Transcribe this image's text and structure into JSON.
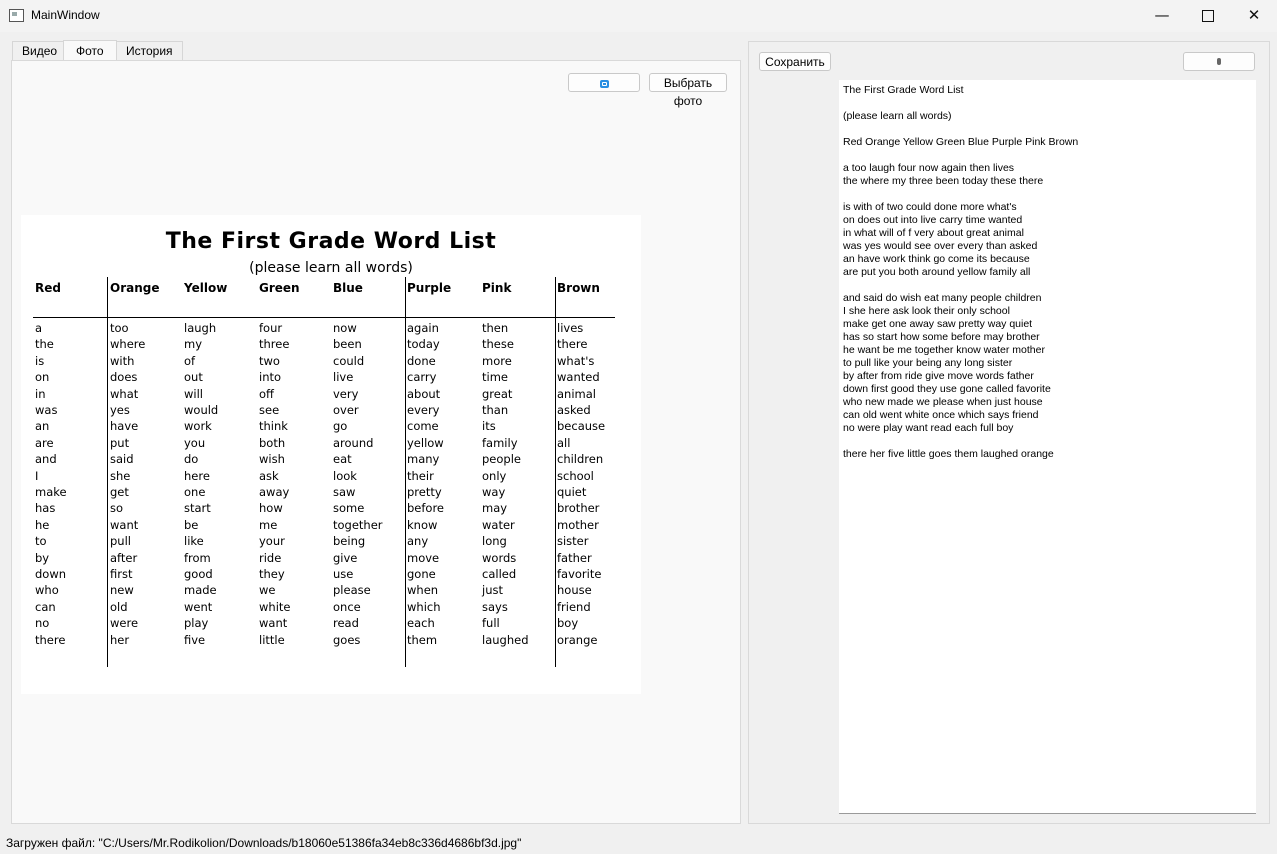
{
  "window": {
    "title": "MainWindow",
    "minimize": "—",
    "close": "✕"
  },
  "tabs": [
    {
      "label": "Видео"
    },
    {
      "label": "Фото"
    },
    {
      "label": "История"
    }
  ],
  "toolbar": {
    "choose_photo": "Выбрать фото",
    "rotate_icon": "rotate-icon"
  },
  "photo": {
    "title": "The First Grade Word List",
    "subtitle": "(please learn all words)",
    "columns": [
      {
        "head": "Red",
        "words": [
          "a",
          "the",
          "is",
          "on",
          "in",
          "was",
          "an",
          "are",
          "and",
          "I",
          "make",
          "has",
          "he",
          "to",
          "by",
          "down",
          "who",
          "can",
          "no",
          "there"
        ]
      },
      {
        "head": "Orange",
        "words": [
          "too",
          "where",
          "with",
          "does",
          "what",
          "yes",
          "have",
          "put",
          "said",
          "she",
          "get",
          "so",
          "want",
          "pull",
          "after",
          "first",
          "new",
          "old",
          "were",
          "her"
        ]
      },
      {
        "head": "Yellow",
        "words": [
          "laugh",
          "my",
          "of",
          "out",
          "will",
          "would",
          "work",
          "you",
          "do",
          "here",
          "one",
          "start",
          "be",
          "like",
          "from",
          "good",
          "made",
          "went",
          "play",
          "five"
        ]
      },
      {
        "head": "Green",
        "words": [
          "four",
          "three",
          "two",
          "into",
          "off",
          "see",
          "think",
          "both",
          "wish",
          "ask",
          "away",
          "how",
          "me",
          "your",
          "ride",
          "they",
          "we",
          "white",
          "want",
          "little"
        ]
      },
      {
        "head": "Blue",
        "words": [
          "now",
          "been",
          "could",
          "live",
          "very",
          "over",
          "go",
          "around",
          "eat",
          "look",
          "saw",
          "some",
          "together",
          "being",
          "give",
          "use",
          "please",
          "once",
          "read",
          "goes"
        ]
      },
      {
        "head": "Purple",
        "words": [
          "again",
          "today",
          "done",
          "carry",
          "about",
          "every",
          "come",
          "yellow",
          "many",
          "their",
          "pretty",
          "before",
          "know",
          "any",
          "move",
          "gone",
          "when",
          "which",
          "each",
          "them"
        ]
      },
      {
        "head": "Pink",
        "words": [
          "then",
          "these",
          "more",
          "time",
          "great",
          "than",
          "its",
          "family",
          "people",
          "only",
          "way",
          "may",
          "water",
          "long",
          "words",
          "called",
          "just",
          "says",
          "full",
          "laughed"
        ]
      },
      {
        "head": "Brown",
        "words": [
          "lives",
          "there",
          "what's",
          "wanted",
          "animal",
          "asked",
          "because",
          "all",
          "children",
          "school",
          "quiet",
          "brother",
          "mother",
          "sister",
          "father",
          "favorite",
          "house",
          "friend",
          "boy",
          "orange"
        ]
      }
    ]
  },
  "right": {
    "save": "Сохранить",
    "mic_icon": "microphone-icon",
    "text_lines": [
      "The First Grade Word List",
      "",
      "(please learn all words)",
      "",
      "Red Orange Yellow Green Blue Purple Pink Brown",
      "",
      "a too laugh four now again then lives",
      "the where my three been today these there",
      "",
      "is with of two could done more what's",
      "on does out into live carry time wanted",
      "in what will of f very about great animal",
      "was yes would see over every than asked",
      "an have work think go come its because",
      "are put you both around yellow family all",
      "",
      "and said do wish eat many people children",
      "I she here ask look their only school",
      "make get one away saw pretty way quiet",
      "has so start how some before may brother",
      "he want be me together know water mother",
      "to pull like your being any long sister",
      "by after from ride give move words father",
      "down first good they use gone called favorite",
      "who new made we please when just house",
      "can old went white once which says friend",
      "no were play want read each full boy",
      "",
      "there her five little goes them laughed orange"
    ]
  },
  "status": "Загружен файл: \"C:/Users/Mr.Rodikolion/Downloads/b18060e51386fa34eb8c336d4686bf3d.jpg\""
}
